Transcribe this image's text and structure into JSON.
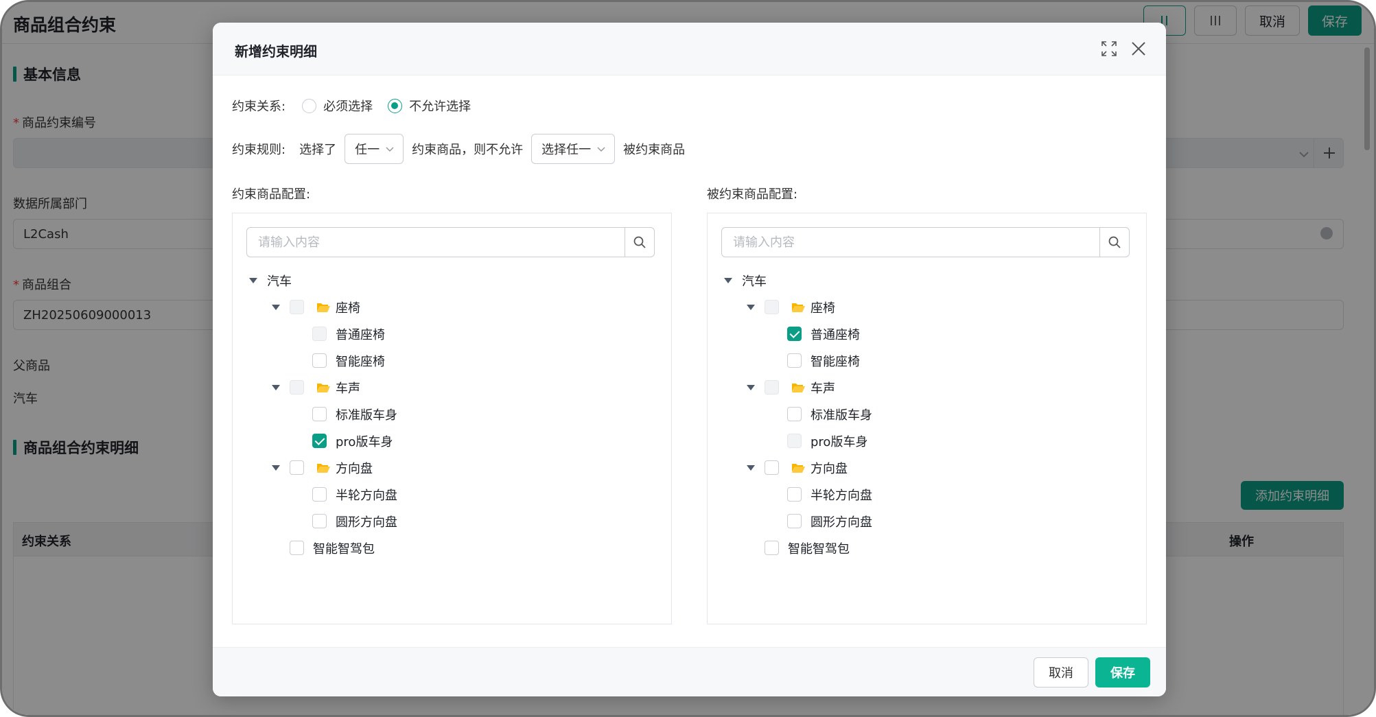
{
  "page": {
    "title": "商品组合约束",
    "top_buttons": {
      "cancel": "取消",
      "save": "保存"
    },
    "sections": {
      "basic_info": "基本信息",
      "details": "商品组合约束明细"
    },
    "fields": {
      "code_label": "商品约束编号",
      "dept_label": "数据所属部门",
      "dept_value": "L2Cash",
      "combo_label": "商品组合",
      "combo_value": "ZH20250609000013",
      "parent_label": "父商品",
      "parent_value": "汽车"
    },
    "add_detail_button": "添加约束明细",
    "table_headers": {
      "relation": "约束关系",
      "action": "操作"
    }
  },
  "modal": {
    "title": "新增约束明细",
    "relation_label": "约束关系:",
    "relation_options": [
      {
        "label": "必须选择",
        "checked": false
      },
      {
        "label": "不允许选择",
        "checked": true
      }
    ],
    "rule": {
      "label": "约束规则:",
      "text1": "选择了",
      "select1": "任一",
      "text2": "约束商品，则不允许",
      "select2": "选择任一",
      "text3": "被约束商品"
    },
    "left_panel": {
      "label": "约束商品配置:",
      "search_placeholder": "请输入内容",
      "tree": [
        {
          "label": "汽车",
          "level": 0,
          "caret": true,
          "checkbox": "none",
          "folder": false
        },
        {
          "label": "座椅",
          "level": 1,
          "caret": true,
          "checkbox": "disabled",
          "folder": true
        },
        {
          "label": "普通座椅",
          "level": 2,
          "caret": false,
          "checkbox": "disabled",
          "folder": false
        },
        {
          "label": "智能座椅",
          "level": 2,
          "caret": false,
          "checkbox": "unchecked",
          "folder": false
        },
        {
          "label": "车声",
          "level": 1,
          "caret": true,
          "checkbox": "disabled",
          "folder": true
        },
        {
          "label": "标准版车身",
          "level": 2,
          "caret": false,
          "checkbox": "unchecked",
          "folder": false
        },
        {
          "label": "pro版车身",
          "level": 2,
          "caret": false,
          "checkbox": "checked",
          "folder": false
        },
        {
          "label": "方向盘",
          "level": 1,
          "caret": true,
          "checkbox": "unchecked",
          "folder": true
        },
        {
          "label": "半轮方向盘",
          "level": 2,
          "caret": false,
          "checkbox": "unchecked",
          "folder": false
        },
        {
          "label": "圆形方向盘",
          "level": 2,
          "caret": false,
          "checkbox": "unchecked",
          "folder": false
        },
        {
          "label": "智能智驾包",
          "level": 1,
          "caret": false,
          "checkbox": "unchecked",
          "folder": false
        }
      ]
    },
    "right_panel": {
      "label": "被约束商品配置:",
      "search_placeholder": "请输入内容",
      "tree": [
        {
          "label": "汽车",
          "level": 0,
          "caret": true,
          "checkbox": "none",
          "folder": false
        },
        {
          "label": "座椅",
          "level": 1,
          "caret": true,
          "checkbox": "disabled",
          "folder": true
        },
        {
          "label": "普通座椅",
          "level": 2,
          "caret": false,
          "checkbox": "checked",
          "folder": false
        },
        {
          "label": "智能座椅",
          "level": 2,
          "caret": false,
          "checkbox": "unchecked",
          "folder": false
        },
        {
          "label": "车声",
          "level": 1,
          "caret": true,
          "checkbox": "disabled",
          "folder": true
        },
        {
          "label": "标准版车身",
          "level": 2,
          "caret": false,
          "checkbox": "unchecked",
          "folder": false
        },
        {
          "label": "pro版车身",
          "level": 2,
          "caret": false,
          "checkbox": "disabled",
          "folder": false
        },
        {
          "label": "方向盘",
          "level": 1,
          "caret": true,
          "checkbox": "unchecked",
          "folder": true
        },
        {
          "label": "半轮方向盘",
          "level": 2,
          "caret": false,
          "checkbox": "unchecked",
          "folder": false
        },
        {
          "label": "圆形方向盘",
          "level": 2,
          "caret": false,
          "checkbox": "unchecked",
          "folder": false
        },
        {
          "label": "智能智驾包",
          "level": 1,
          "caret": false,
          "checkbox": "unchecked",
          "folder": false
        }
      ]
    },
    "footer": {
      "cancel": "取消",
      "save": "保存"
    }
  },
  "colors": {
    "primary": "#0b9e86",
    "primary_light": "#0bb593",
    "folder": "#f7b500"
  }
}
